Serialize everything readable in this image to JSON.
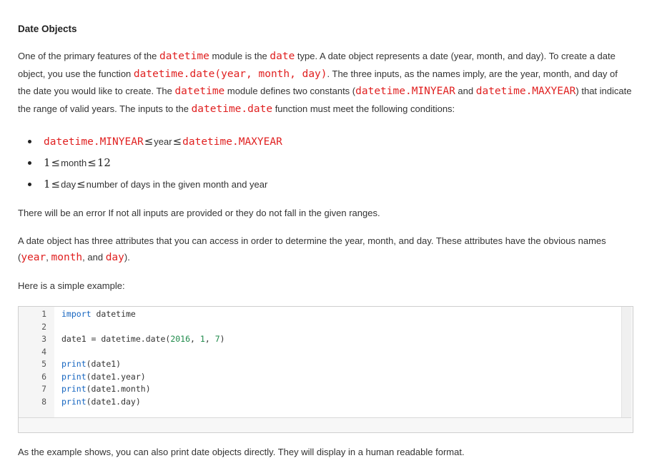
{
  "heading": "Date Objects",
  "intro": {
    "t1": "One of the primary features of the ",
    "c1": "datetime",
    "t2": " module is the ",
    "c2": "date",
    "t3": " type. A date object represents a date (year, month, and day). To create a date object, you use the function ",
    "c3": "datetime.date(year, month, day)",
    "t4": ". The three inputs, as the names imply, are the year, month, and day of the date you would like to create. The ",
    "c4": "datetime",
    "t5": " module defines two constants (",
    "c5": "datetime.MINYEAR",
    "t6": " and ",
    "c6": "datetime.MAXYEAR",
    "t7": ") that indicate the range of valid years. The inputs to the ",
    "c7": "datetime.date",
    "t8": " function must meet the following conditions:"
  },
  "conditions": {
    "c1_left": "datetime.MINYEAR",
    "c1_mid": "year",
    "c1_right": "datetime.MAXYEAR",
    "c2_left": "1",
    "c2_mid": "month",
    "c2_right": "12",
    "c3_left": "1",
    "c3_mid": "day",
    "c3_right": "number of days in the given month and year",
    "le": "≤"
  },
  "error_text": "There will be an error If not all inputs are provided or they do not fall in the given ranges.",
  "attrs": {
    "t1": "A date object has three attributes that you can access in order to determine the year, month, and day. These attributes have the obvious names (",
    "a1": "year",
    "sep1": ", ",
    "a2": "month",
    "t2": ", and ",
    "a3": "day",
    "t3": ")."
  },
  "example_intro": "Here is a simple example:",
  "code": {
    "line1_num": "1",
    "line1_kw": "import",
    "line1_rest": " datetime",
    "line2_num": "2",
    "line3_num": "3",
    "line3_a": "date1 = datetime.date(",
    "line3_n1": "2016",
    "line3_b": ", ",
    "line3_n2": "1",
    "line3_c": ", ",
    "line3_n3": "7",
    "line3_d": ")",
    "line4_num": "4",
    "line5_num": "5",
    "line5_kw": "print",
    "line5_rest": "(date1)",
    "line6_num": "6",
    "line6_kw": "print",
    "line6_rest": "(date1.year)",
    "line7_num": "7",
    "line7_kw": "print",
    "line7_rest": "(date1.month)",
    "line8_num": "8",
    "line8_kw": "print",
    "line8_rest": "(date1.day)"
  },
  "closing": "As the example shows, you can also print date objects directly. They will display in a human readable format."
}
